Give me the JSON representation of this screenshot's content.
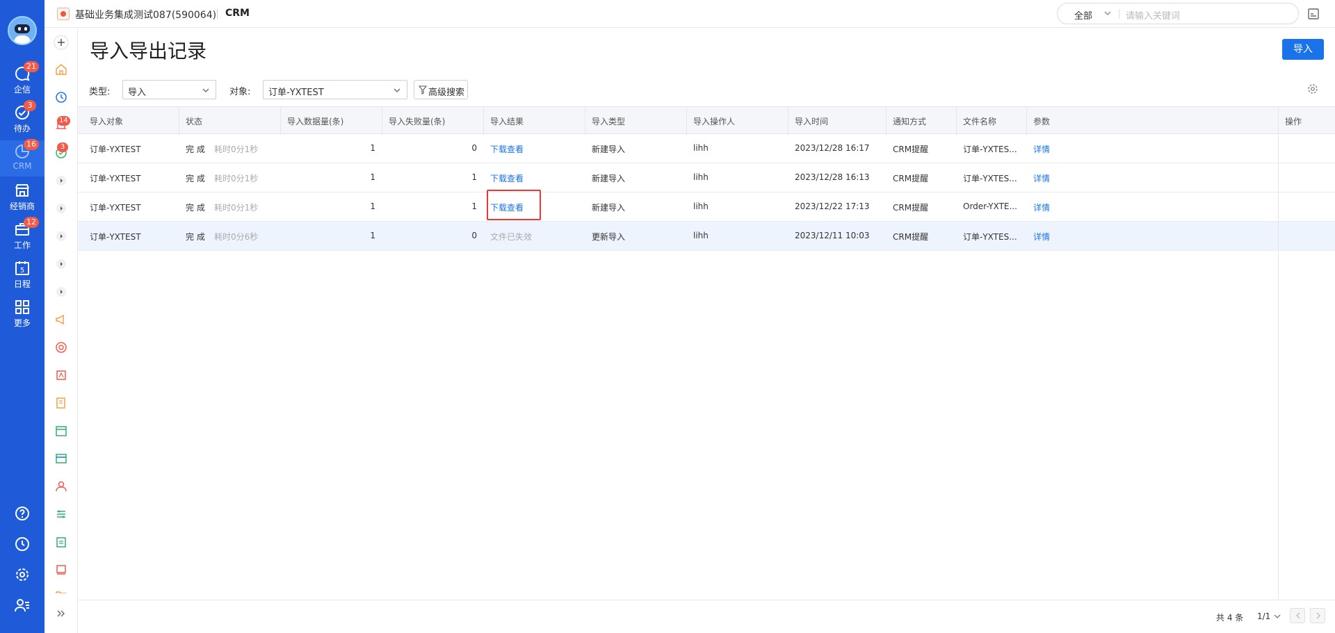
{
  "colors": {
    "nav_bg": "#1f5bd8",
    "accent": "#1a73e8",
    "badge": "#f25a4a",
    "highlight": "#e53935"
  },
  "topbar": {
    "company": "基础业务集成测试087(590064)",
    "app_name": "CRM",
    "search_scope": "全部",
    "search_placeholder": "请输入关键词"
  },
  "nav": {
    "items": [
      {
        "label": "企信",
        "badge": "21",
        "icon": "chat-icon"
      },
      {
        "label": "待办",
        "badge": "3",
        "icon": "check-circle-icon"
      },
      {
        "label": "CRM",
        "badge": "16",
        "icon": "crm-icon"
      },
      {
        "label": "经销商",
        "badge": "",
        "icon": "store-icon"
      },
      {
        "label": "工作",
        "badge": "12",
        "icon": "briefcase-icon"
      },
      {
        "label": "日程",
        "badge": "",
        "icon": "calendar-icon",
        "day": "5"
      },
      {
        "label": "更多",
        "badge": "",
        "icon": "grid-icon"
      }
    ],
    "bottom_icons": [
      "help-icon",
      "clock-icon",
      "settings-icon",
      "user-list-icon"
    ]
  },
  "subnav": {
    "badges": {
      "bell": "14",
      "check": "3"
    },
    "icons": [
      "plus-icon",
      "home-icon",
      "clock-icon",
      "bell-icon",
      "check-icon",
      "expand-icon",
      "expand-icon",
      "expand-icon",
      "expand-icon",
      "expand-icon",
      "megaphone-icon",
      "target-icon",
      "contract-icon",
      "document-icon",
      "archive-icon",
      "screen-icon",
      "person-icon",
      "flow-icon",
      "clipboard-icon",
      "report-icon",
      "folder-icon",
      "collapse-icon"
    ]
  },
  "page": {
    "title": "导入导出记录",
    "import_button": "导入",
    "filters": {
      "type_label": "类型:",
      "type_value": "导入",
      "object_label": "对象:",
      "object_value": "订单-YXTEST",
      "advanced_search": "高级搜索"
    }
  },
  "table": {
    "columns": [
      "导入对象",
      "状态",
      "导入数据量(条)",
      "导入失败量(条)",
      "导入结果",
      "导入类型",
      "导入操作人",
      "导入时间",
      "通知方式",
      "文件名称",
      "参数",
      "操作"
    ],
    "rows": [
      {
        "object": "订单-YXTEST",
        "status": "完 成",
        "duration": "耗时0分1秒",
        "count": "1",
        "failed": "0",
        "result": "下载查看",
        "result_link": true,
        "type": "新建导入",
        "operator": "lihh",
        "time": "2023/12/28 16:17",
        "notify": "CRM提醒",
        "file": "订单-YXTES...",
        "params": "详情"
      },
      {
        "object": "订单-YXTEST",
        "status": "完 成",
        "duration": "耗时0分1秒",
        "count": "1",
        "failed": "1",
        "result": "下载查看",
        "result_link": true,
        "type": "新建导入",
        "operator": "lihh",
        "time": "2023/12/28 16:13",
        "notify": "CRM提醒",
        "file": "订单-YXTES...",
        "params": "详情"
      },
      {
        "object": "订单-YXTEST",
        "status": "完 成",
        "duration": "耗时0分1秒",
        "count": "1",
        "failed": "1",
        "result": "下载查看",
        "result_link": true,
        "type": "新建导入",
        "operator": "lihh",
        "time": "2023/12/22 17:13",
        "notify": "CRM提醒",
        "file": "Order-YXTE...",
        "params": "详情"
      },
      {
        "object": "订单-YXTEST",
        "status": "完 成",
        "duration": "耗时0分6秒",
        "count": "1",
        "failed": "0",
        "result": "文件已失效",
        "result_link": false,
        "type": "更新导入",
        "operator": "lihh",
        "time": "2023/12/11 10:03",
        "notify": "CRM提醒",
        "file": "订单-YXTES...",
        "params": "详情"
      }
    ]
  },
  "footer": {
    "total": "共 4 条",
    "page": "1/1"
  }
}
